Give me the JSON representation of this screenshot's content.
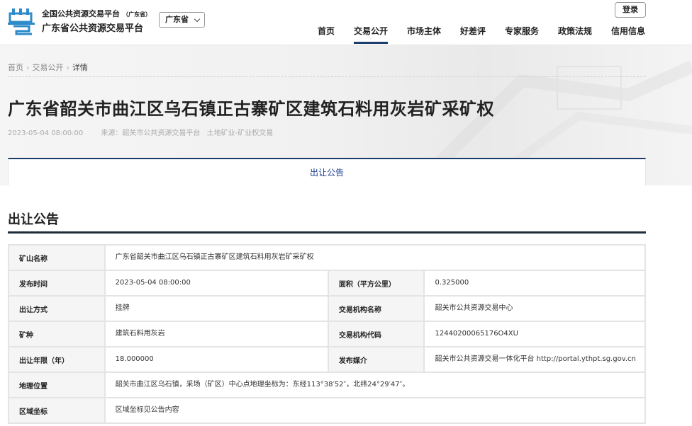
{
  "header": {
    "site_name": "全国公共资源交易平台",
    "site_region_tag": "（广东省）",
    "platform_name": "广东省公共资源交易平台",
    "region_select": "广东省",
    "login_label": "登录",
    "nav": [
      {
        "label": "首页"
      },
      {
        "label": "交易公开"
      },
      {
        "label": "市场主体"
      },
      {
        "label": "好差评"
      },
      {
        "label": "专家服务"
      },
      {
        "label": "政策法规"
      },
      {
        "label": "信用信息"
      }
    ],
    "active_nav": "交易公开",
    "brand_color": "#1a3d6e",
    "logo_color": "#2e8bc9"
  },
  "breadcrumb": {
    "home": "首页",
    "section": "交易公开",
    "current": "详情",
    "separator": "›"
  },
  "article": {
    "title": "广东省韶关市曲江区乌石镇正古寨矿区建筑石料用灰岩矿采矿权",
    "date": "2023-05-04 08:00:00",
    "source": "来源：韶关市公共资源交易平台",
    "category": "土地矿业-矿业权交易",
    "tab_label": "出让公告"
  },
  "section": {
    "title": "出让公告"
  },
  "table": {
    "mine_name_label": "矿山名称",
    "mine_name": "广东省韶关市曲江区乌石镇正古寨矿区建筑石料用灰岩矿采矿权",
    "publish_time_label": "发布时间",
    "publish_time": "2023-05-04 08:00:00",
    "area_label": "面积（平方公里）",
    "area": "0.325000",
    "transfer_method_label": "出让方式",
    "transfer_method": "挂牌",
    "agency_name_label": "交易机构名称",
    "agency_name": "韶关市公共资源交易中心",
    "mineral_label": "矿种",
    "mineral": "建筑石料用灰岩",
    "agency_code_label": "交易机构代码",
    "agency_code": "12440200065176O4XU",
    "term_label": "出让年限（年）",
    "term": "18.000000",
    "media_label": "发布媒介",
    "media": "韶关市公共资源交易一体化平台 http://portal.ythpt.sg.gov.cn",
    "location_label": "地理位置",
    "location": "韶关市曲江区乌石镇，采场（矿区）中心点地理坐标为：东经113°38′52″，北纬24°29′47″。",
    "coords_label": "区域坐标",
    "coords": "区域坐标见公告内容"
  }
}
